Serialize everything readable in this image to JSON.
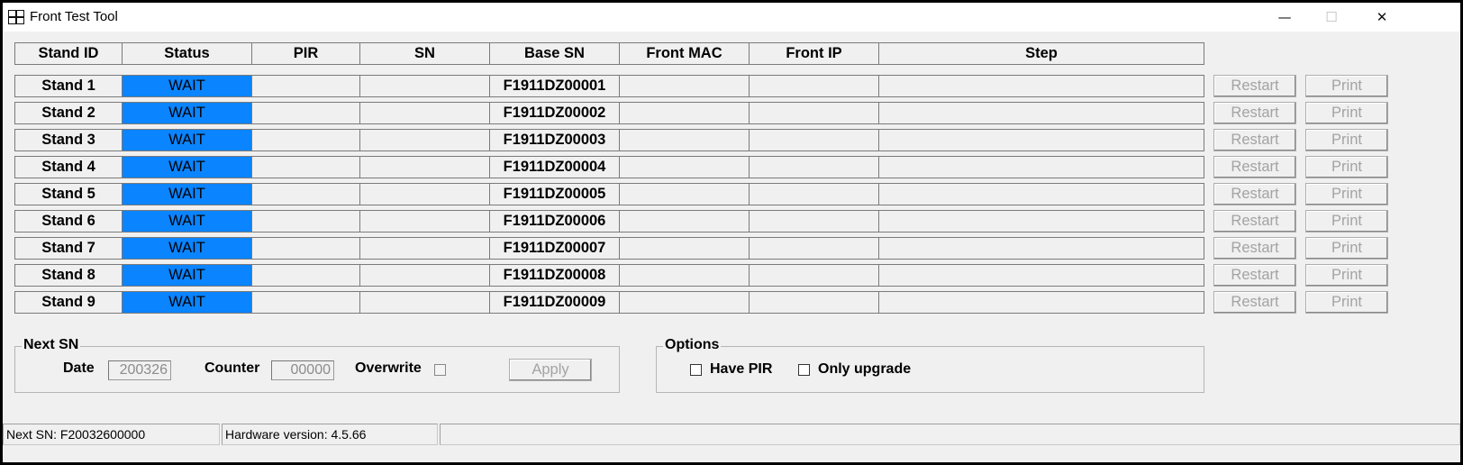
{
  "window": {
    "title": "Front Test Tool",
    "minimize_glyph": "—",
    "maximize_glyph": "☐",
    "close_glyph": "✕"
  },
  "columns": [
    "Stand ID",
    "Status",
    "PIR",
    "SN",
    "Base SN",
    "Front MAC",
    "Front IP",
    "Step"
  ],
  "rows": [
    {
      "stand_id": "Stand 1",
      "status": "WAIT",
      "pir": "",
      "sn": "",
      "base_sn": "F1911DZ00001",
      "front_mac": "",
      "front_ip": "",
      "step": "",
      "restart_label": "Restart",
      "print_label": "Print"
    },
    {
      "stand_id": "Stand 2",
      "status": "WAIT",
      "pir": "",
      "sn": "",
      "base_sn": "F1911DZ00002",
      "front_mac": "",
      "front_ip": "",
      "step": "",
      "restart_label": "Restart",
      "print_label": "Print"
    },
    {
      "stand_id": "Stand 3",
      "status": "WAIT",
      "pir": "",
      "sn": "",
      "base_sn": "F1911DZ00003",
      "front_mac": "",
      "front_ip": "",
      "step": "",
      "restart_label": "Restart",
      "print_label": "Print"
    },
    {
      "stand_id": "Stand 4",
      "status": "WAIT",
      "pir": "",
      "sn": "",
      "base_sn": "F1911DZ00004",
      "front_mac": "",
      "front_ip": "",
      "step": "",
      "restart_label": "Restart",
      "print_label": "Print"
    },
    {
      "stand_id": "Stand 5",
      "status": "WAIT",
      "pir": "",
      "sn": "",
      "base_sn": "F1911DZ00005",
      "front_mac": "",
      "front_ip": "",
      "step": "",
      "restart_label": "Restart",
      "print_label": "Print"
    },
    {
      "stand_id": "Stand 6",
      "status": "WAIT",
      "pir": "",
      "sn": "",
      "base_sn": "F1911DZ00006",
      "front_mac": "",
      "front_ip": "",
      "step": "",
      "restart_label": "Restart",
      "print_label": "Print"
    },
    {
      "stand_id": "Stand 7",
      "status": "WAIT",
      "pir": "",
      "sn": "",
      "base_sn": "F1911DZ00007",
      "front_mac": "",
      "front_ip": "",
      "step": "",
      "restart_label": "Restart",
      "print_label": "Print"
    },
    {
      "stand_id": "Stand 8",
      "status": "WAIT",
      "pir": "",
      "sn": "",
      "base_sn": "F1911DZ00008",
      "front_mac": "",
      "front_ip": "",
      "step": "",
      "restart_label": "Restart",
      "print_label": "Print"
    },
    {
      "stand_id": "Stand 9",
      "status": "WAIT",
      "pir": "",
      "sn": "",
      "base_sn": "F1911DZ00009",
      "front_mac": "",
      "front_ip": "",
      "step": "",
      "restart_label": "Restart",
      "print_label": "Print"
    }
  ],
  "next_sn_group": {
    "legend": "Next SN",
    "date_label": "Date",
    "date_value": "200326",
    "counter_label": "Counter",
    "counter_value": "00000",
    "overwrite_label": "Overwrite",
    "overwrite_checked": false,
    "apply_label": "Apply"
  },
  "options_group": {
    "legend": "Options",
    "have_pir_label": "Have PIR",
    "have_pir_checked": false,
    "only_upgrade_label": "Only upgrade",
    "only_upgrade_checked": false
  },
  "statusbar": {
    "next_sn": "Next SN: F20032600000",
    "hardware_version": "Hardware version: 4.5.66",
    "extra": ""
  },
  "colors": {
    "status_wait": "#0a84ff",
    "window_bg": "#f0f0f0",
    "disabled_text": "#a3a3a3"
  }
}
